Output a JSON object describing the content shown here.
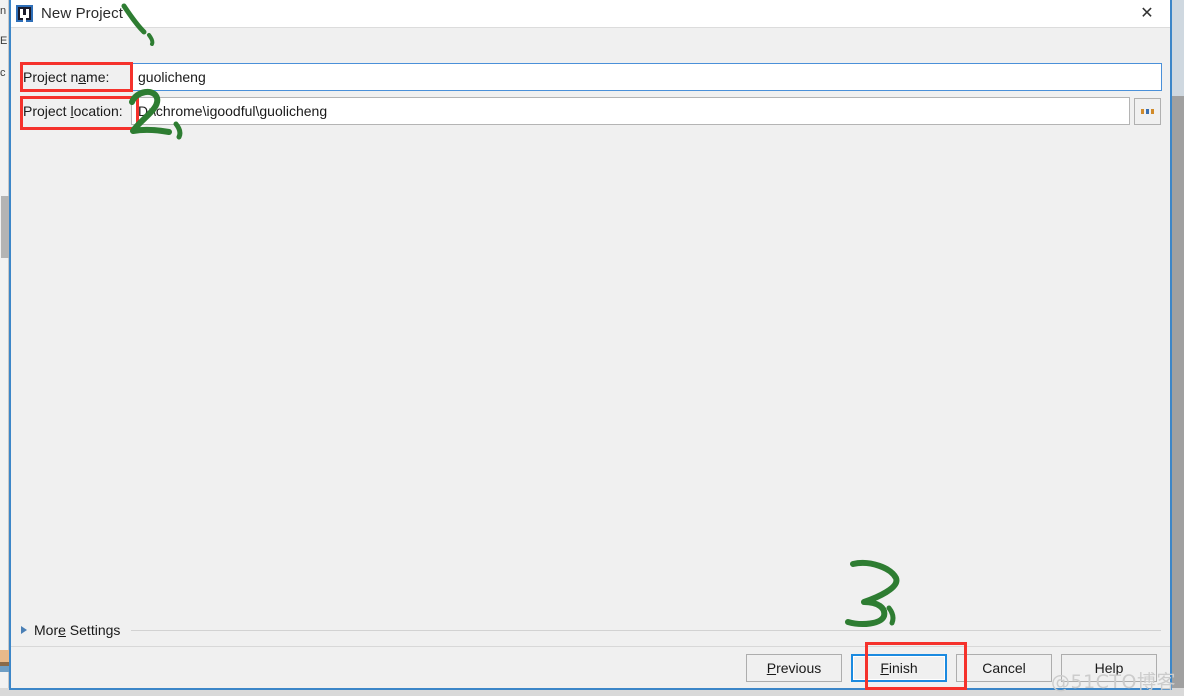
{
  "window": {
    "title": "New Project",
    "app_icon": "intellij-idea-icon",
    "close_icon": "close-icon"
  },
  "form": {
    "fields": [
      {
        "label": "Project name:",
        "mnemonic": "a",
        "value": "guolicheng",
        "focused": true
      },
      {
        "label": "Project location:",
        "mnemonic": "l",
        "value": "D:\\chrome\\igoodful\\guolicheng",
        "focused": false,
        "browse_label": "...",
        "browse_icon": "ellipsis-icon"
      }
    ]
  },
  "more_settings": {
    "label": "More Settings",
    "mnemonic": "e",
    "expander_icon": "chevron-right-icon",
    "expanded": false
  },
  "buttons": [
    {
      "label": "Previous",
      "mnemonic": "P",
      "focused": false
    },
    {
      "label": "Finish",
      "mnemonic": "F",
      "focused": true
    },
    {
      "label": "Cancel",
      "mnemonic": "",
      "focused": false
    },
    {
      "label": "Help",
      "mnemonic": "",
      "focused": false
    }
  ],
  "annotations": {
    "red_boxes": [
      "project-name-label",
      "project-location-label",
      "finish-button"
    ],
    "ink_marks": [
      {
        "text": "1,",
        "target": "project-name"
      },
      {
        "text": "2,",
        "target": "project-location"
      },
      {
        "text": "3,",
        "target": "finish-button"
      }
    ],
    "ink_color": "#2e7d32",
    "box_color": "#f5322c"
  },
  "watermark": {
    "text": "@51CTO博客"
  },
  "colors": {
    "dialog_border": "#3c86c8",
    "dialog_bg": "#f0f0f0",
    "focus_blue": "#1b8ae0",
    "field_focus_border": "#4a90d9",
    "annotation_red": "#f5322c",
    "annotation_green": "#2e7d32"
  },
  "background_window": {
    "glyphs": [
      "n",
      "E",
      "c"
    ]
  }
}
